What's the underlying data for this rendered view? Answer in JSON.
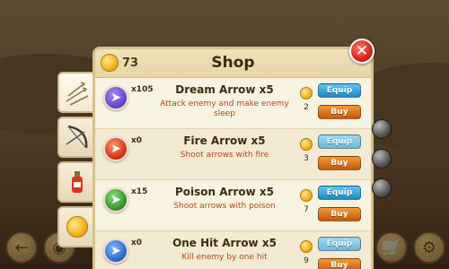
{
  "header": {
    "coins": "73",
    "title": "Shop",
    "close_icon": "close-icon"
  },
  "tabs": [
    {
      "name": "arrows",
      "icon": "arrows-icon",
      "active": true
    },
    {
      "name": "bows",
      "icon": "bow-icon",
      "active": false
    },
    {
      "name": "potions",
      "icon": "potion-icon",
      "active": false
    },
    {
      "name": "coins",
      "icon": "coin-icon",
      "active": false
    }
  ],
  "items": [
    {
      "qty": "x105",
      "name": "Dream Arrow x5",
      "desc": "Attack enemy and make enemy sleep",
      "price": "2",
      "equip": "Equip",
      "buy": "Buy",
      "icon_color": "#6b4ad0",
      "icon": "dream-arrow-icon"
    },
    {
      "qty": "x0",
      "name": "Fire Arrow x5",
      "desc": "Shoot arrows with fire",
      "price": "3",
      "equip": "Equip",
      "buy": "Buy",
      "icon_color": "#d8371e",
      "icon": "fire-arrow-icon"
    },
    {
      "qty": "x15",
      "name": "Poison Arrow x5",
      "desc": "Shoot arrows with poison",
      "price": "7",
      "equip": "Equip",
      "buy": "Buy",
      "icon_color": "#3a9a2e",
      "icon": "poison-arrow-icon"
    },
    {
      "qty": "x0",
      "name": "One Hit Arrow x5",
      "desc": "Kill enemy by one hit",
      "price": "9",
      "equip": "Equip",
      "buy": "Buy",
      "icon_color": "#2f6fd0",
      "icon": "one-hit-arrow-icon"
    }
  ],
  "corner_buttons": {
    "left": [
      "back-icon",
      "camera-icon"
    ],
    "right": [
      "cart-icon",
      "settings-icon"
    ]
  },
  "colors": {
    "equip": "#1d8ac6",
    "buy": "#c15a0c",
    "description": "#b7451a",
    "close": "#d6241a"
  }
}
